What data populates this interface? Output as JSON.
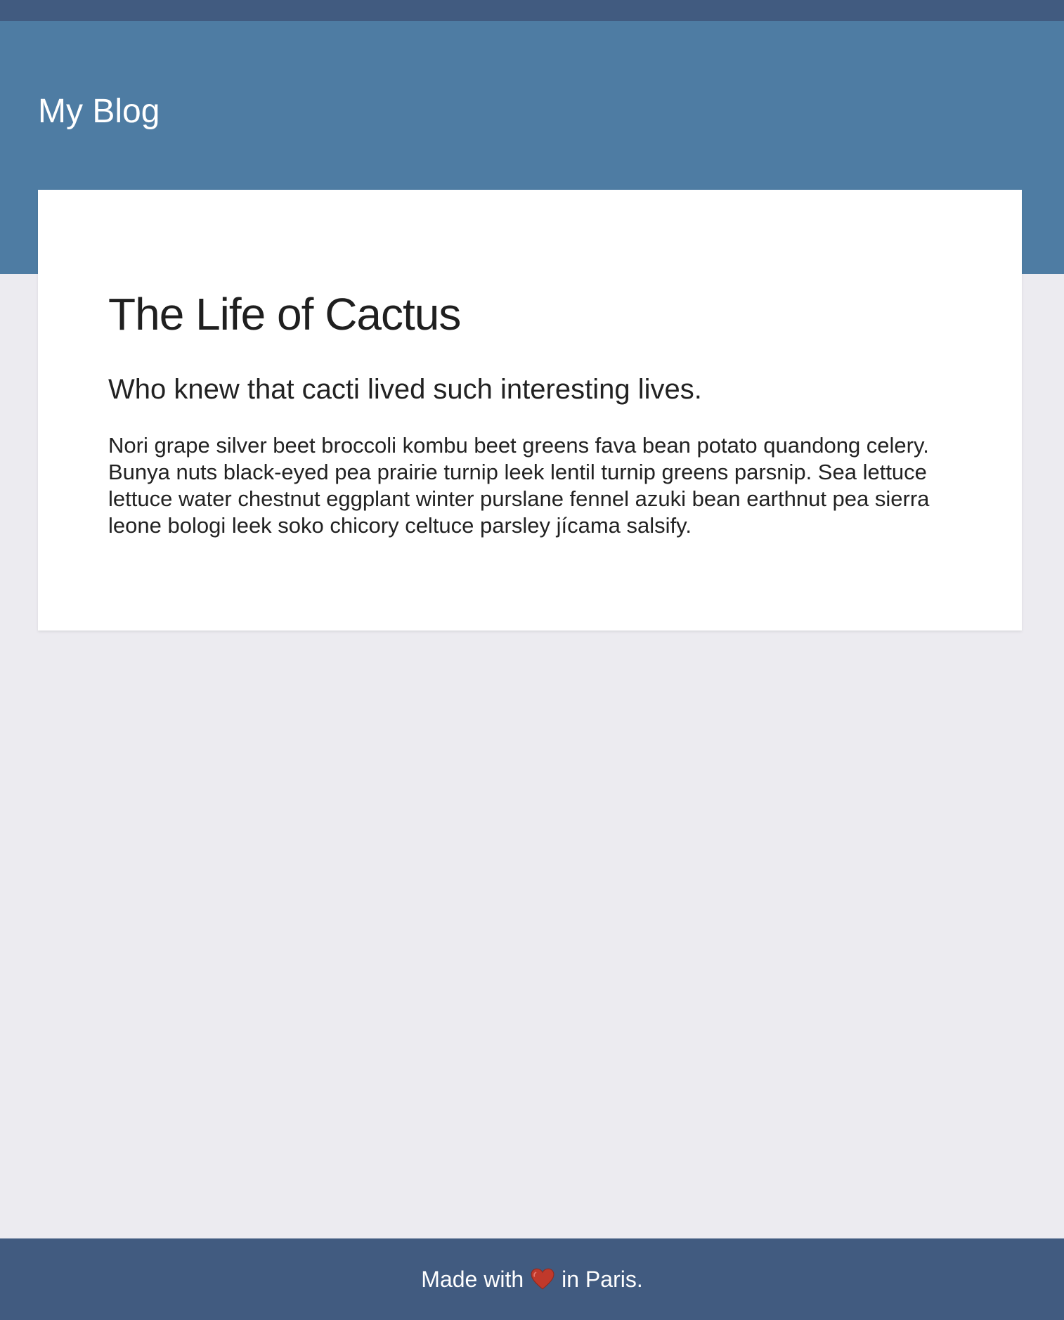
{
  "header": {
    "site_title": "My Blog"
  },
  "post": {
    "title": "The Life of Cactus",
    "subtitle": "Who knew that cacti lived such interesting lives.",
    "body": "Nori grape silver beet broccoli kombu beet greens fava bean potato quandong celery. Bunya nuts black-eyed pea prairie turnip leek lentil turnip greens parsnip. Sea lettuce lettuce water chestnut eggplant winter purslane fennel azuki bean earthnut pea sierra leone bologi leek soko chicory celtuce parsley jícama salsify."
  },
  "footer": {
    "text_before": "Made with",
    "icon": "heart-icon",
    "text_after": "in Paris."
  },
  "colors": {
    "header_bg": "#4E7CA3",
    "top_strip_bg": "#415B80",
    "footer_bg": "#415B80",
    "page_bg": "#ECEBF0",
    "heart": "#C0392B"
  }
}
